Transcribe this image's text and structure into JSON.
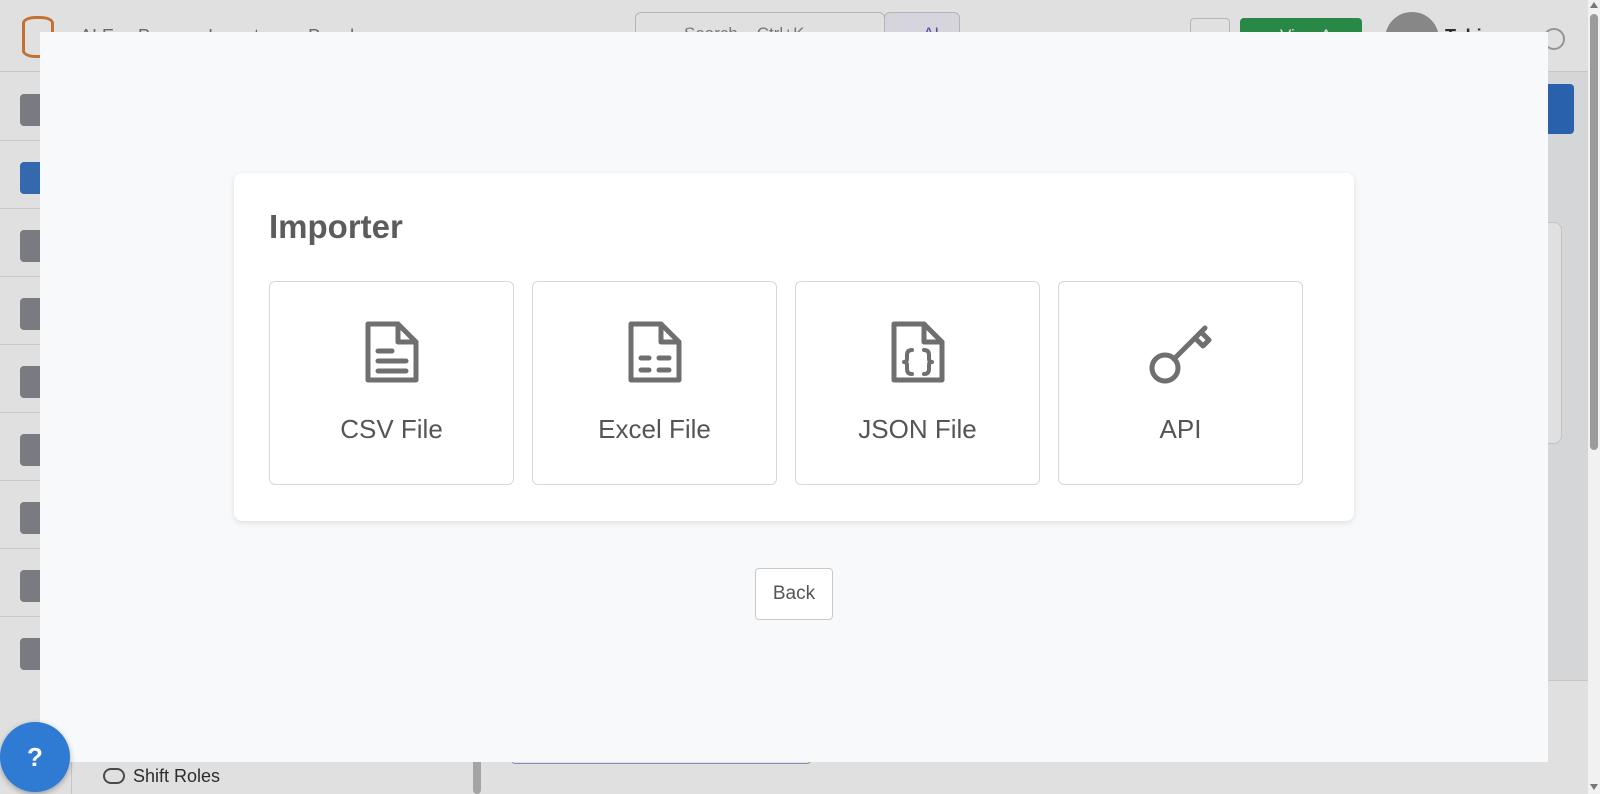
{
  "background": {
    "breadcrumbs": [
      "AI Eve Po...",
      "Importer",
      "Popul..."
    ],
    "search_placeholder": "Search... Ctrl+K",
    "ai_label": "AI",
    "view_app_label": "View App",
    "user_name": "Tobias",
    "shift_roles_label": "Shift Roles"
  },
  "modal": {
    "title": "Importer",
    "options": [
      {
        "label": "CSV File",
        "icon": "csv-file-icon"
      },
      {
        "label": "Excel File",
        "icon": "excel-file-icon"
      },
      {
        "label": "JSON File",
        "icon": "json-file-icon"
      },
      {
        "label": "API",
        "icon": "api-key-icon"
      }
    ],
    "back_label": "Back"
  },
  "help": {
    "label": "?"
  },
  "colors": {
    "accent": "#2f7bd4",
    "success": "#2e9b4f",
    "icon_gray": "#6f6f6f"
  }
}
